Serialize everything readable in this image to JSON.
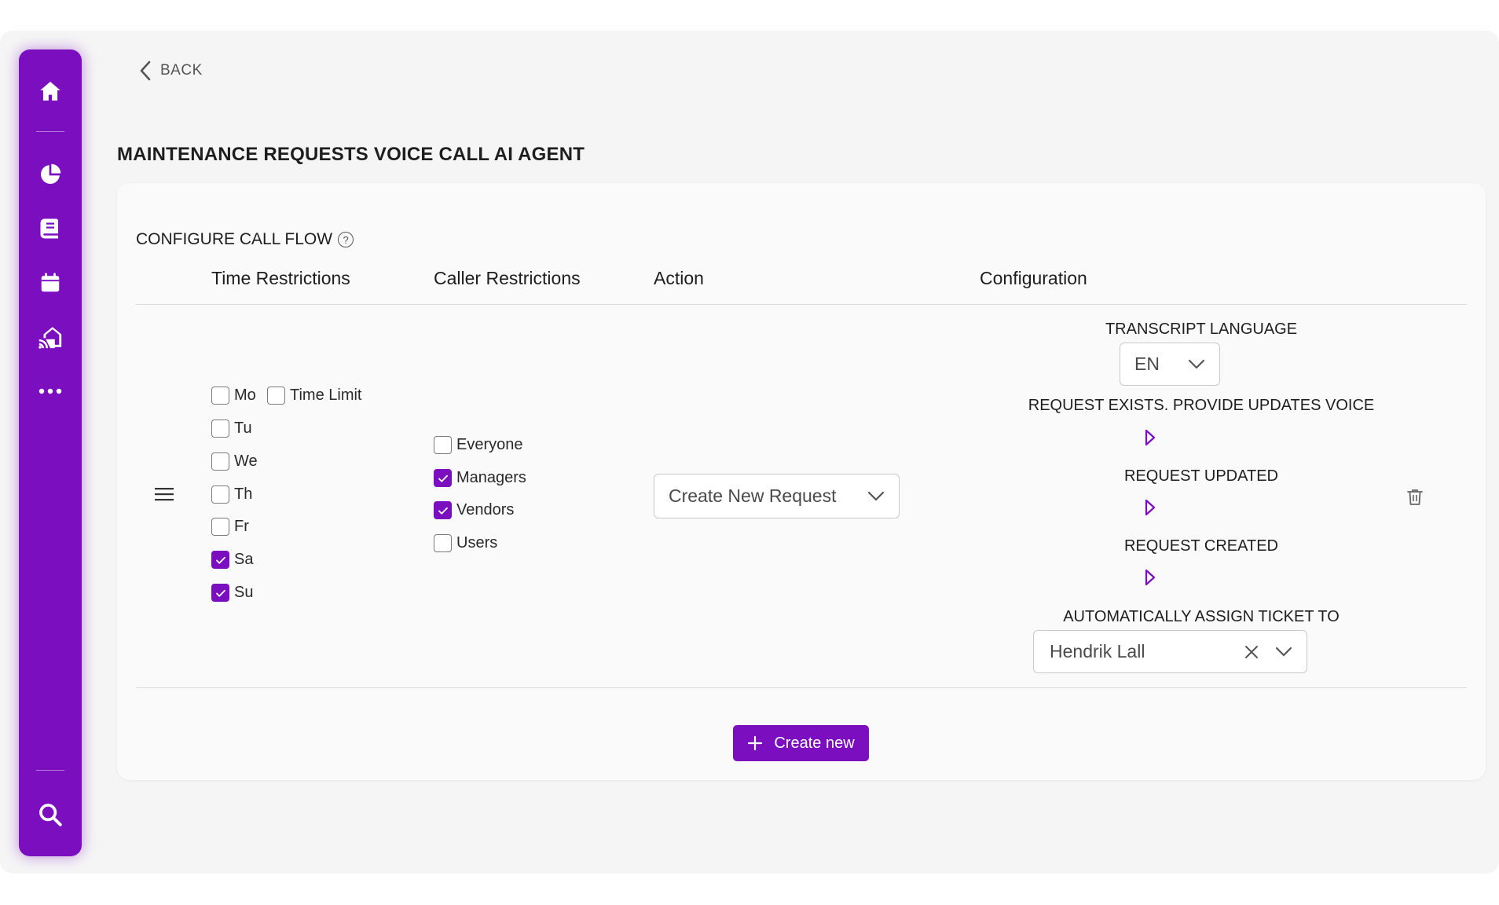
{
  "sidebar": {
    "items": [
      {
        "icon": "home-icon"
      },
      {
        "icon": "pie-chart-icon"
      },
      {
        "icon": "document-icon"
      },
      {
        "icon": "calendar-icon"
      },
      {
        "icon": "smart-home-icon"
      },
      {
        "icon": "more-icon"
      }
    ],
    "bottom_icon": "search-icon",
    "accent_color": "#7b0fc0"
  },
  "back_label": "BACK",
  "page_title": "MAINTENANCE REQUESTS VOICE CALL AI AGENT",
  "section": {
    "title": "CONFIGURE CALL FLOW",
    "help_icon": "?"
  },
  "columns": [
    "Time Restrictions",
    "Caller Restrictions",
    "Action",
    "Configuration"
  ],
  "row": {
    "days": [
      {
        "label": "Mo",
        "checked": false
      },
      {
        "label": "Tu",
        "checked": false
      },
      {
        "label": "We",
        "checked": false
      },
      {
        "label": "Th",
        "checked": false
      },
      {
        "label": "Fr",
        "checked": false
      },
      {
        "label": "Sa",
        "checked": true
      },
      {
        "label": "Su",
        "checked": true
      }
    ],
    "time_limit": {
      "label": "Time Limit",
      "checked": false
    },
    "callers": [
      {
        "label": "Everyone",
        "checked": false
      },
      {
        "label": "Managers",
        "checked": true
      },
      {
        "label": "Vendors",
        "checked": true
      },
      {
        "label": "Users",
        "checked": false
      }
    ],
    "action": {
      "value": "Create New Request"
    },
    "config": {
      "transcript_language_label": "TRANSCRIPT LANGUAGE",
      "transcript_language_value": "EN",
      "voice_labels": [
        "REQUEST EXISTS. PROVIDE UPDATES VOICE",
        "REQUEST UPDATED",
        "REQUEST CREATED"
      ],
      "assign_label": "AUTOMATICALLY ASSIGN TICKET TO",
      "assign_value": "Hendrik Lall"
    }
  },
  "create_button_label": "Create new"
}
